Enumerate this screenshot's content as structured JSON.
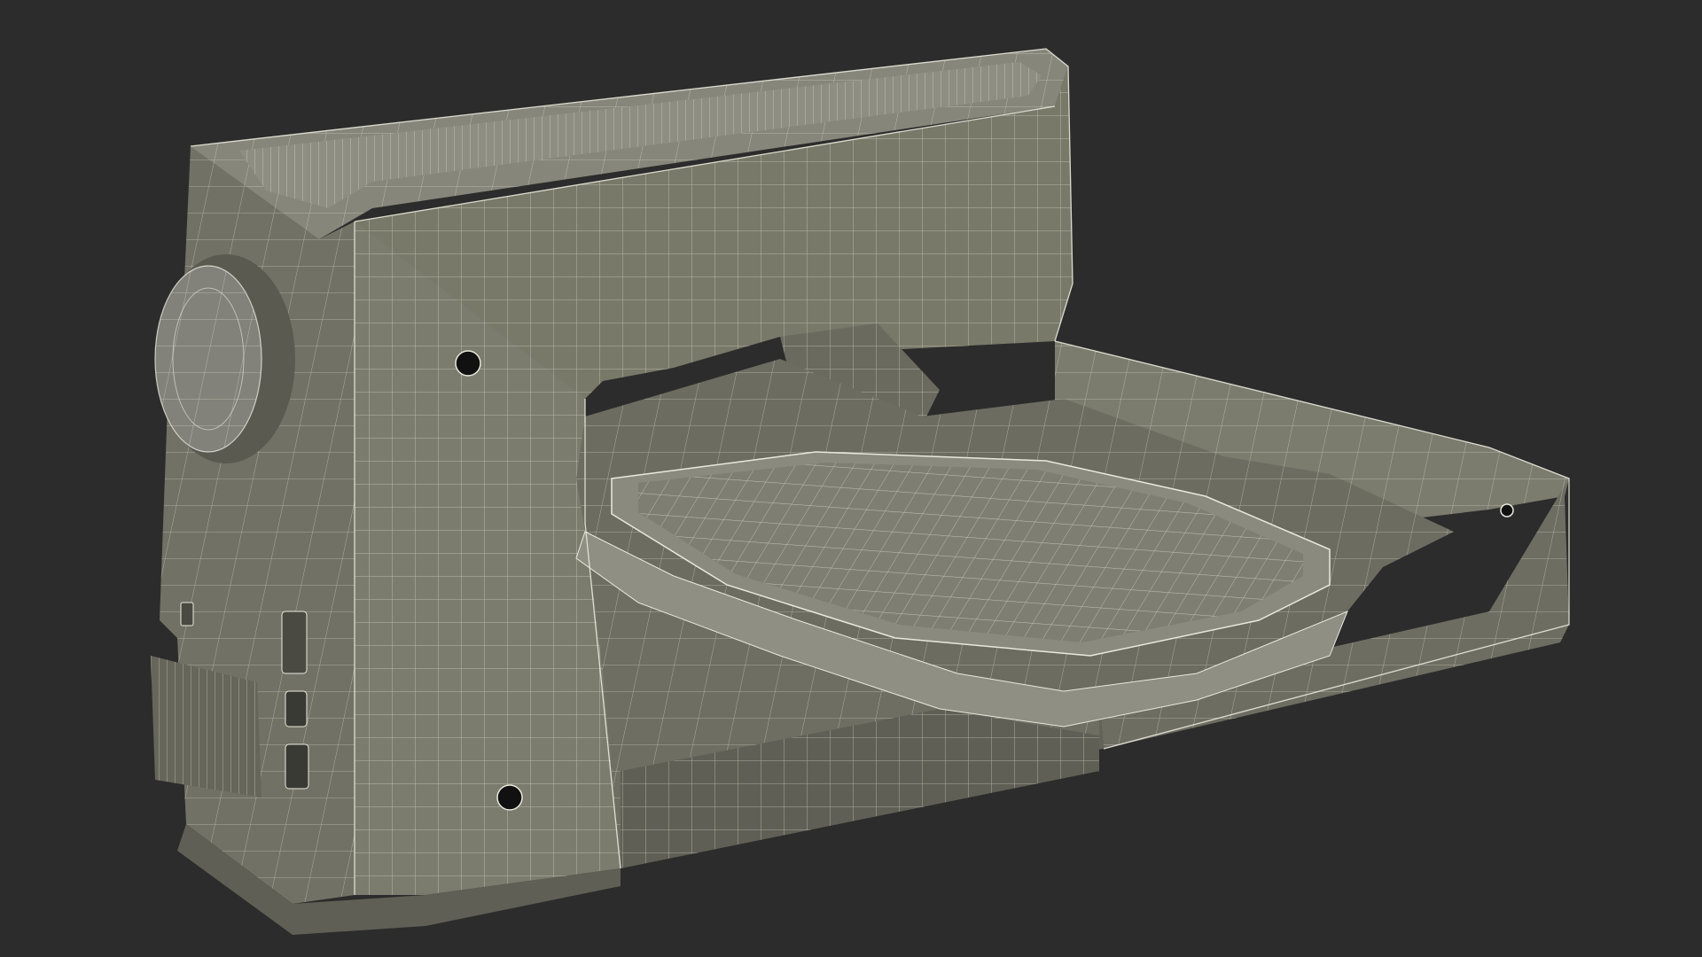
{
  "scene": {
    "subject": "sewing-machine",
    "render_style": "wireframe",
    "colors": {
      "background": "#2c2c2c",
      "surface": "#787868",
      "surface_light": "#86867a",
      "surface_dark": "#5f5f55",
      "shadow": "#4e4e46",
      "wire": "#e9e9dd",
      "hole": "#111111"
    },
    "grid": {
      "columns": 16,
      "rows": 14
    }
  }
}
